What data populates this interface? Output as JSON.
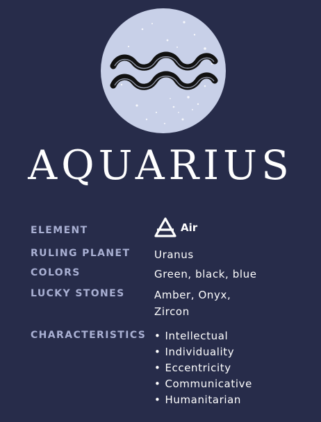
{
  "title": "AQUARIUS",
  "element": {
    "label": "ELEMENT",
    "value": "Air",
    "icon": "air-triangle-icon"
  },
  "ruling_planet": {
    "label": "RULING PLANET",
    "value": "Uranus"
  },
  "colors": {
    "label": "COLORS",
    "value": "Green, black, blue"
  },
  "lucky_stones": {
    "label": "LUCKY STONES",
    "lines": [
      "Amber, Onyx,",
      "Zircon"
    ]
  },
  "characteristics": {
    "label": "CHARACTERISTICS",
    "items": [
      "Intellectual",
      "Individuality",
      "Eccentricity",
      "Communicative",
      "Humanitarian"
    ]
  },
  "colors_theme": {
    "background": "#272c4a",
    "moon": "#c8d0e8",
    "label": "#a9b0d3",
    "text": "#ffffff"
  },
  "emblem": "aquarius-symbol-icon"
}
